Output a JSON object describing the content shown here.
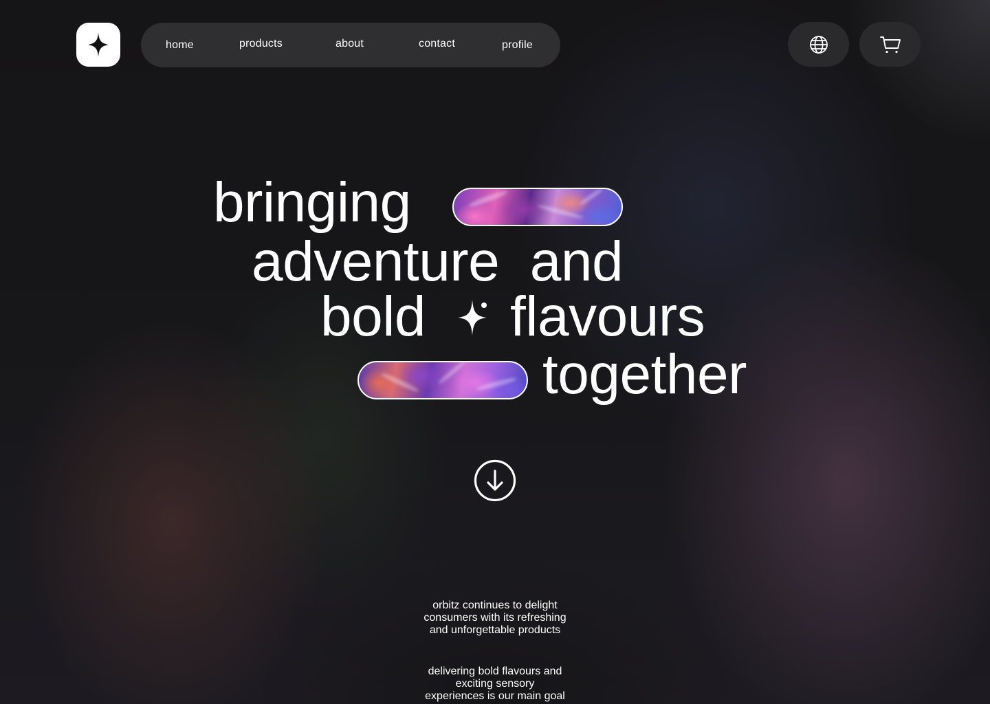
{
  "brand": {
    "logo_icon": "sparkle-icon"
  },
  "nav": {
    "items": [
      {
        "label": "home"
      },
      {
        "label": "products"
      },
      {
        "label": "about"
      },
      {
        "label": "contact"
      },
      {
        "label": "profile"
      }
    ]
  },
  "actions": {
    "language_icon": "globe-icon",
    "cart_icon": "cart-icon"
  },
  "hero": {
    "line1": "bringing",
    "line2": "adventure  and",
    "line3_left": "bold",
    "line3_right": "flavours",
    "line4": "together",
    "inline_icon": "sparkle-icon",
    "scroll_icon": "arrow-down-circle-icon"
  },
  "intro": {
    "paragraph1": [
      "orbitz continues to delight",
      "consumers with its refreshing",
      "and unforgettable products"
    ],
    "paragraph2": [
      "delivering bold flavours and",
      "exciting sensory",
      "experiences is our main goal"
    ]
  },
  "colors": {
    "background": "#151416",
    "nav_bg": "#2f2f31",
    "button_bg": "#2a2a2c",
    "text": "#ffffff",
    "accent_pink": "#e060b8",
    "accent_purple": "#7b3fb8"
  }
}
